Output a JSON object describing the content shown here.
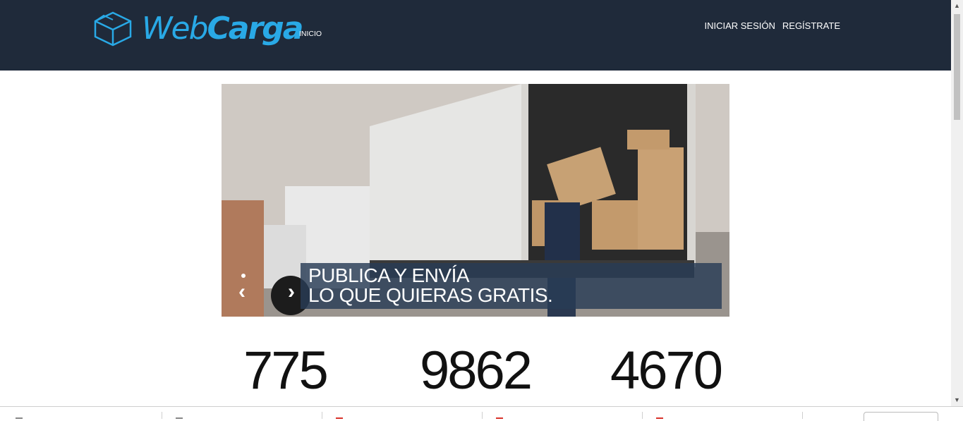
{
  "brand": {
    "name_web": "Web",
    "name_carga": "Carga",
    "color": "#29a9e6"
  },
  "nav": {
    "inicio": "INICIO",
    "login": "INICIAR SESIÓN",
    "register": "REGÍSTRATE"
  },
  "hero": {
    "caption_line1": "PUBLICA Y ENVÍA",
    "caption_line2": "LO QUE QUIERAS GRATIS."
  },
  "stats": [
    "775",
    "9862",
    "4670"
  ],
  "colors": {
    "header_bg": "#1f2a3a",
    "caption_bg": "#283c55",
    "accent_red": "#d9342b"
  }
}
